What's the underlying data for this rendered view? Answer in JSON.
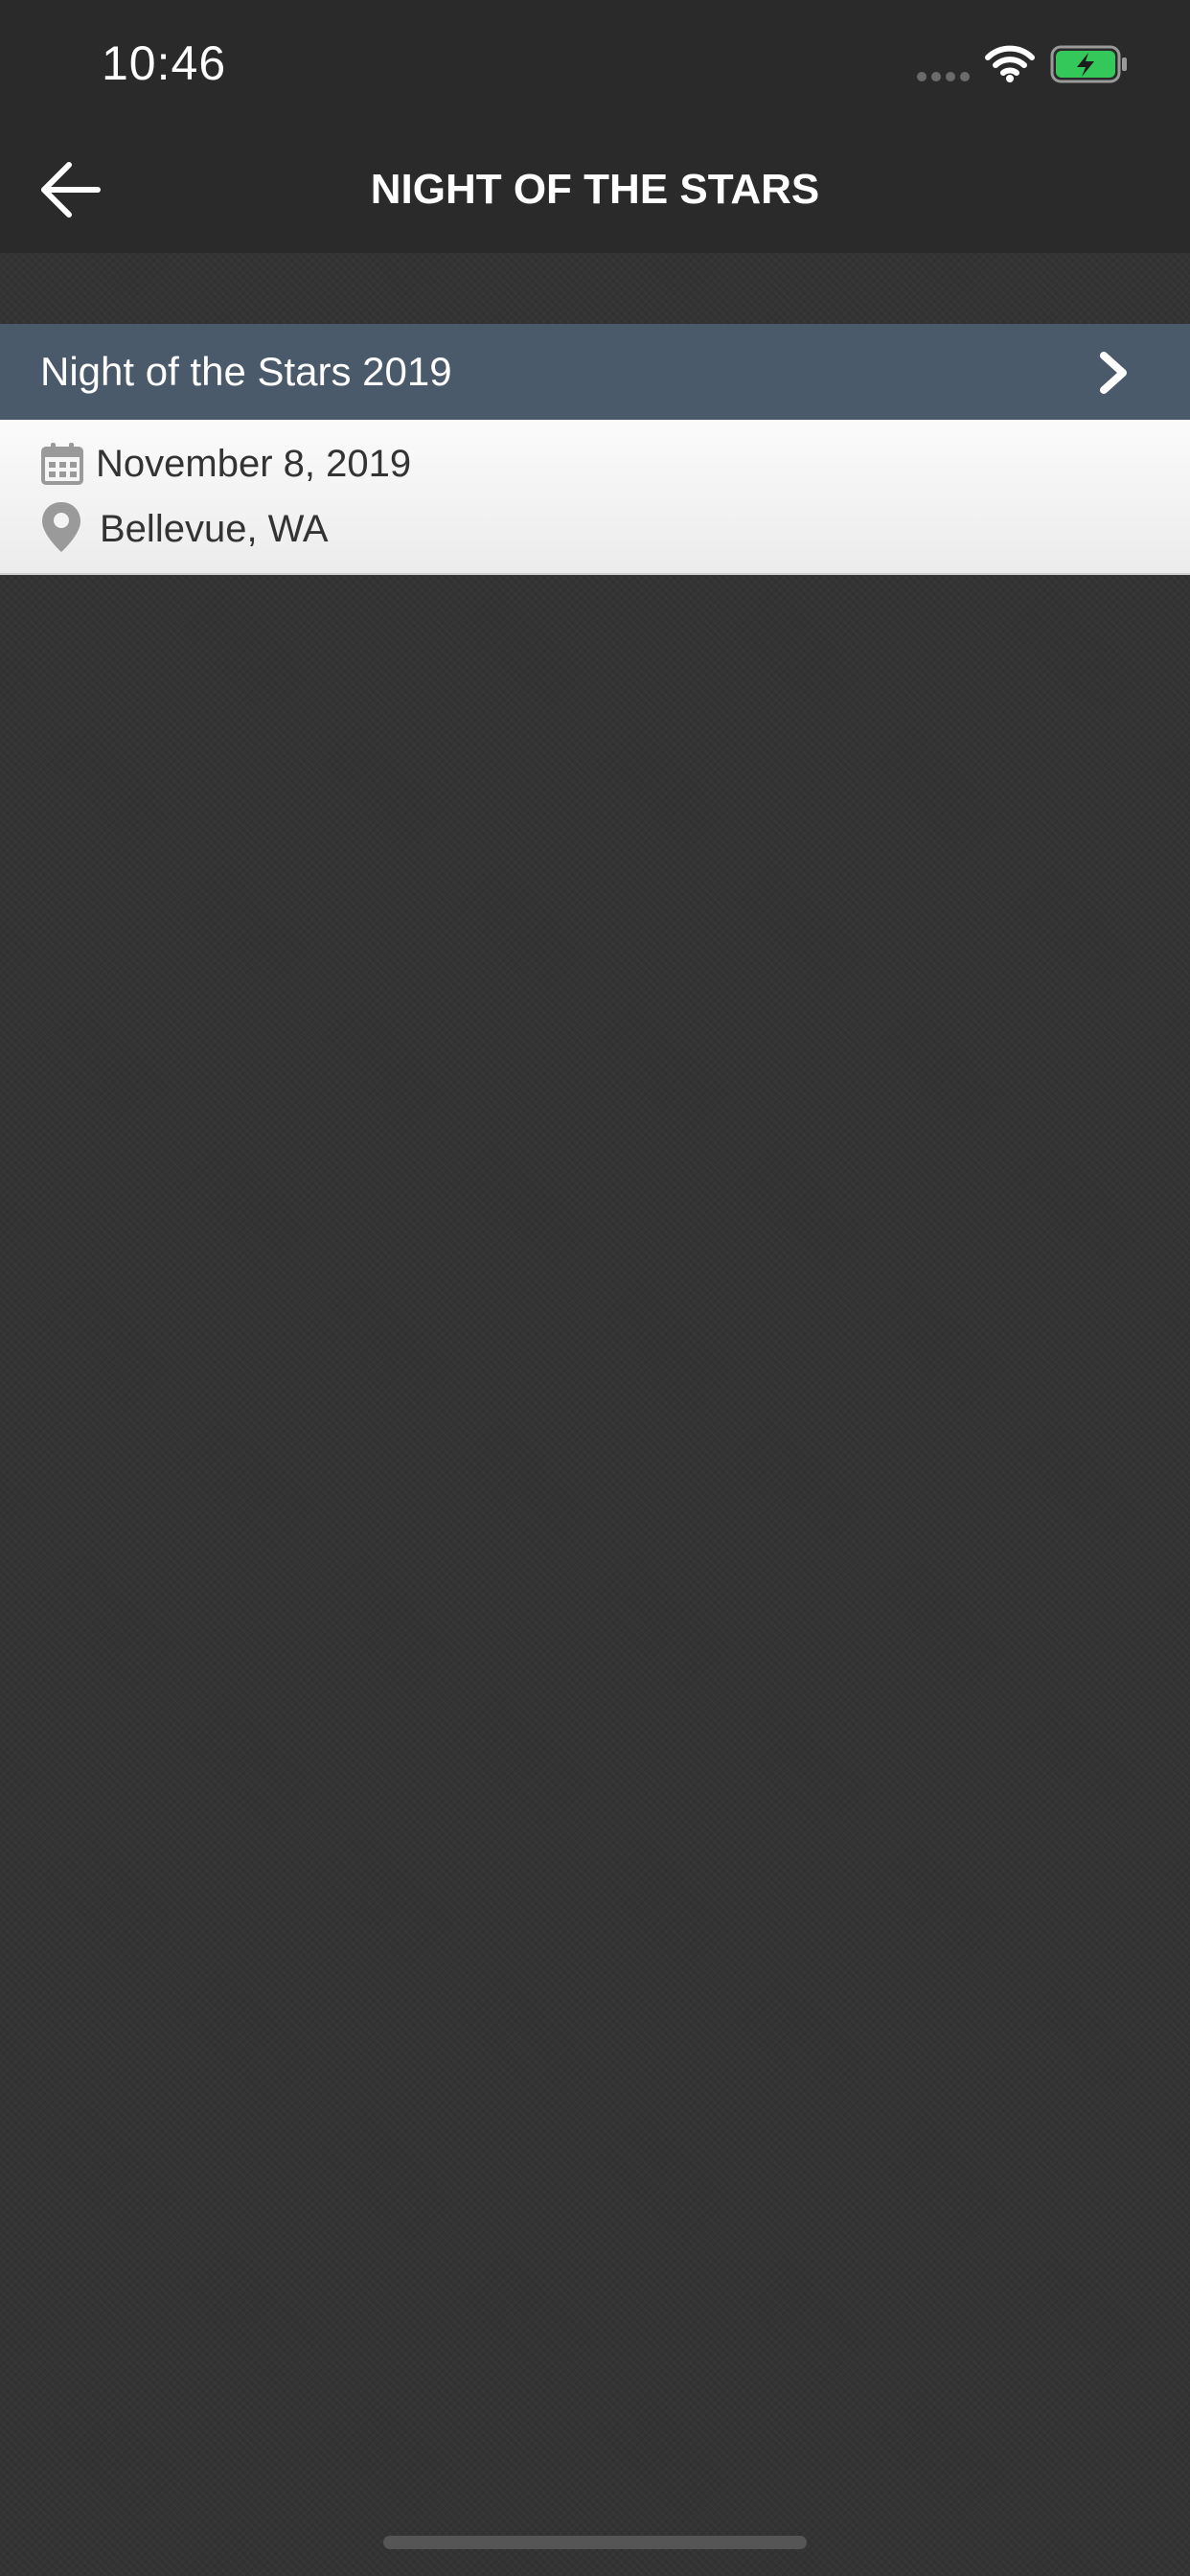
{
  "status_bar": {
    "time": "10:46",
    "icons": [
      "signal-dots-icon",
      "wifi-icon",
      "battery-charging-icon"
    ],
    "battery_color": "#34c759"
  },
  "nav": {
    "title": "NIGHT OF THE STARS",
    "back_icon": "arrow-left-icon"
  },
  "event": {
    "title": "Night of the Stars 2019",
    "date": "November 8, 2019",
    "location": "Bellevue, WA",
    "date_icon": "calendar-icon",
    "location_icon": "map-pin-icon",
    "chevron_icon": "chevron-right-icon",
    "header_color": "#4a5a6a"
  },
  "colors": {
    "background": "#333333",
    "bar": "#2a2a2a"
  }
}
